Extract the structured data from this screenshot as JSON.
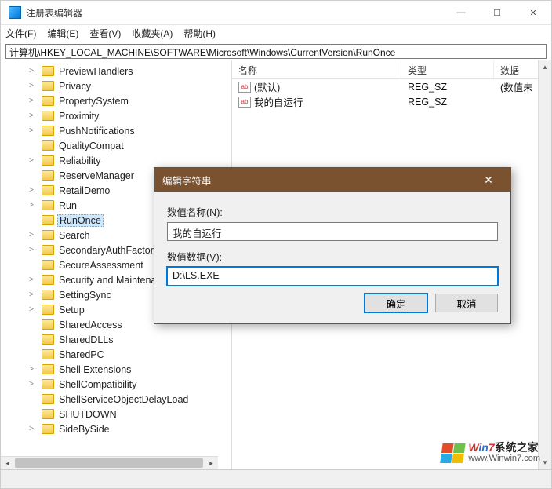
{
  "window": {
    "title": "注册表编辑器",
    "minimize": "—",
    "maximize": "☐",
    "close": "✕"
  },
  "menu": {
    "file": "文件(F)",
    "edit": "编辑(E)",
    "view": "查看(V)",
    "favorites": "收藏夹(A)",
    "help": "帮助(H)"
  },
  "address": "计算机\\HKEY_LOCAL_MACHINE\\SOFTWARE\\Microsoft\\Windows\\CurrentVersion\\RunOnce",
  "tree": {
    "items": [
      {
        "label": "PreviewHandlers",
        "exp": ">",
        "indent": 1
      },
      {
        "label": "Privacy",
        "exp": ">",
        "indent": 1
      },
      {
        "label": "PropertySystem",
        "exp": ">",
        "indent": 1
      },
      {
        "label": "Proximity",
        "exp": ">",
        "indent": 1
      },
      {
        "label": "PushNotifications",
        "exp": ">",
        "indent": 1
      },
      {
        "label": "QualityCompat",
        "exp": "",
        "indent": 1
      },
      {
        "label": "Reliability",
        "exp": ">",
        "indent": 1
      },
      {
        "label": "ReserveManager",
        "exp": "",
        "indent": 1
      },
      {
        "label": "RetailDemo",
        "exp": ">",
        "indent": 1
      },
      {
        "label": "Run",
        "exp": ">",
        "indent": 1
      },
      {
        "label": "RunOnce",
        "exp": "",
        "indent": 1,
        "selected": true
      },
      {
        "label": "Search",
        "exp": ">",
        "indent": 1
      },
      {
        "label": "SecondaryAuthFactor",
        "exp": ">",
        "indent": 1
      },
      {
        "label": "SecureAssessment",
        "exp": "",
        "indent": 1
      },
      {
        "label": "Security and Maintenance",
        "exp": ">",
        "indent": 1
      },
      {
        "label": "SettingSync",
        "exp": ">",
        "indent": 1
      },
      {
        "label": "Setup",
        "exp": ">",
        "indent": 1
      },
      {
        "label": "SharedAccess",
        "exp": "",
        "indent": 1
      },
      {
        "label": "SharedDLLs",
        "exp": "",
        "indent": 1
      },
      {
        "label": "SharedPC",
        "exp": "",
        "indent": 1
      },
      {
        "label": "Shell Extensions",
        "exp": ">",
        "indent": 1
      },
      {
        "label": "ShellCompatibility",
        "exp": ">",
        "indent": 1
      },
      {
        "label": "ShellServiceObjectDelayLoad",
        "exp": "",
        "indent": 1
      },
      {
        "label": "SHUTDOWN",
        "exp": "",
        "indent": 1
      },
      {
        "label": "SideBySide",
        "exp": ">",
        "indent": 1
      }
    ]
  },
  "list": {
    "columns": {
      "name": "名称",
      "type": "类型",
      "data": "数据"
    },
    "rows": [
      {
        "name": "(默认)",
        "type": "REG_SZ",
        "data": "(数值未"
      },
      {
        "name": "我的自运行",
        "type": "REG_SZ",
        "data": ""
      }
    ]
  },
  "dialog": {
    "title": "编辑字符串",
    "name_label": "数值名称(N):",
    "name_value": "我的自运行",
    "data_label": "数值数据(V):",
    "data_value": "D:\\LS.EXE",
    "ok": "确定",
    "cancel": "取消",
    "close": "✕"
  },
  "watermark": {
    "brand_w": "W",
    "brand_in": "in",
    "brand_7": "7",
    "brand_cn": "系统之家",
    "url": "www.Winwin7.com"
  }
}
